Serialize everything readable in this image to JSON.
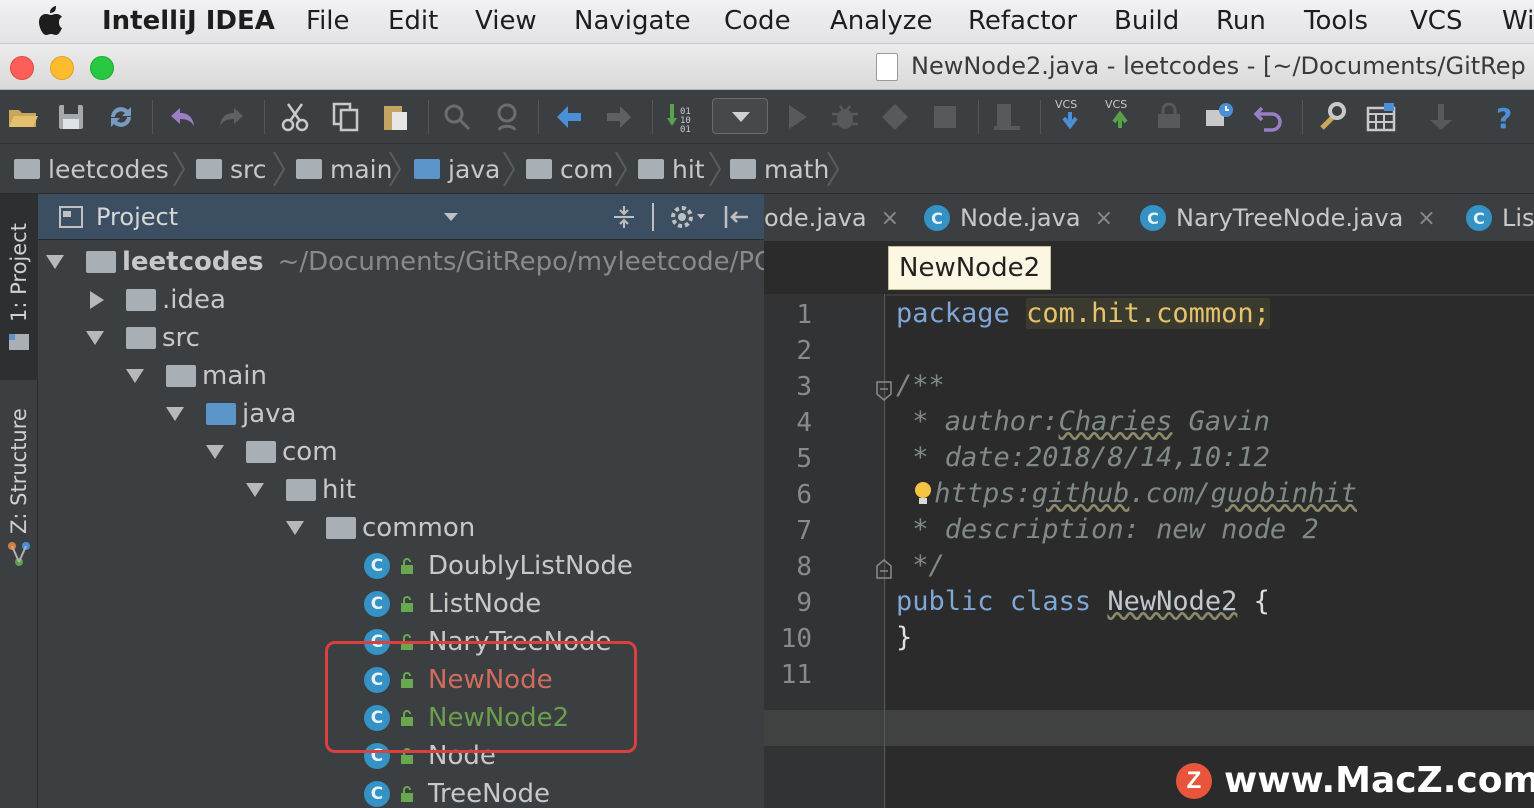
{
  "menubar": {
    "app_name": "IntelliJ IDEA",
    "items": [
      "File",
      "Edit",
      "View",
      "Navigate",
      "Code",
      "Analyze",
      "Refactor",
      "Build",
      "Run",
      "Tools",
      "VCS",
      "Wi"
    ]
  },
  "window": {
    "title": "NewNode2.java - leetcodes - [~/Documents/GitRep"
  },
  "toolbar": {
    "icons": [
      "open-folder-icon",
      "save-icon",
      "sync-icon",
      "undo-icon",
      "redo-icon",
      "cut-icon",
      "copy-icon",
      "paste-icon",
      "find-icon",
      "replace-icon",
      "back-icon",
      "forward-icon",
      "build-icon",
      "run-config-dropdown",
      "run-icon",
      "debug-icon",
      "coverage-icon",
      "stop-icon",
      "device-icon",
      "vcs-update-icon",
      "vcs-commit-icon",
      "vcs-history-icon",
      "vcs-compare-icon",
      "revert-icon",
      "settings-icon",
      "structure-icon",
      "sdk-icon",
      "help-icon"
    ],
    "vcs_label": "VCS"
  },
  "breadcrumb": [
    "leetcodes",
    "src",
    "main",
    "java",
    "com",
    "hit",
    "math"
  ],
  "left_strip": {
    "project_tab": "1: Project",
    "structure_tab": "Z: Structure"
  },
  "project_panel": {
    "title": "Project",
    "tree": [
      {
        "label": "leetcodes",
        "path": "~/Documents/GitRepo/myleetcode/PC"
      },
      {
        "label": ".idea"
      },
      {
        "label": "src"
      },
      {
        "label": "main"
      },
      {
        "label": "java"
      },
      {
        "label": "com"
      },
      {
        "label": "hit"
      },
      {
        "label": "common"
      },
      {
        "label": "DoublyListNode"
      },
      {
        "label": "ListNode"
      },
      {
        "label": "NaryTreeNode"
      },
      {
        "label": "NewNode"
      },
      {
        "label": "NewNode2"
      },
      {
        "label": "Node"
      },
      {
        "label": "TreeNode"
      }
    ],
    "class_icon_letter": "C"
  },
  "editor": {
    "tabs": [
      {
        "label": "ode.java"
      },
      {
        "label": "Node.java"
      },
      {
        "label": "NaryTreeNode.java"
      },
      {
        "label": "Lis"
      }
    ],
    "tab_close": "×",
    "breadcrumb_popup": "NewNode2",
    "line_numbers": [
      "1",
      "2",
      "3",
      "4",
      "5",
      "6",
      "7",
      "8",
      "9",
      "10",
      "11"
    ],
    "code": {
      "l1_kw": "package",
      "l1_pkg": "com.hit.common;",
      "l3": "/**",
      "l4_a": " * author:",
      "l4_b": "Charies",
      "l4_c": " Gavin",
      "l5": " * date:2018/8/14,10:12",
      "l6_a": "https:",
      "l6_b": "github",
      "l6_c": ".com/",
      "l6_d": "guobinhit",
      "l7": " * description: new node 2",
      "l8": " */",
      "l9_kw1": "public",
      "l9_kw2": "class",
      "l9_name": "NewNode2",
      "l9_brace": " {",
      "l10": "}"
    }
  },
  "watermark": {
    "logo": "Z",
    "text": "www.MacZ.com"
  }
}
